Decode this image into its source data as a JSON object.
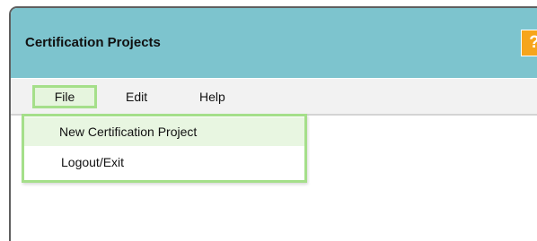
{
  "window": {
    "title": "Certification Projects",
    "help_label": "?"
  },
  "menu": {
    "items": [
      {
        "label": "File",
        "state": "open"
      },
      {
        "label": "Edit"
      },
      {
        "label": "Help"
      }
    ]
  },
  "file_menu": {
    "items": [
      {
        "label": "New Certification Project",
        "state": "highlighted"
      },
      {
        "label": "Logout/Exit"
      }
    ]
  },
  "colors": {
    "title_bar": "#7dc4ce",
    "help_button": "#f6a51c",
    "menu_highlight_border": "#a5df8a",
    "menu_highlight_background": "#e8f6e1",
    "menu_bar": "#f2f2f2"
  }
}
